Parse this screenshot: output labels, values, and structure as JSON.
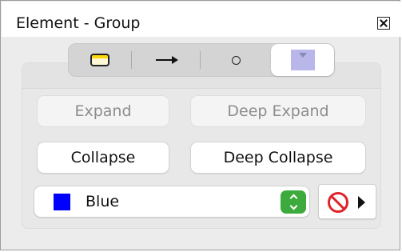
{
  "window": {
    "title": "Element - Group"
  },
  "toolbar": {
    "segments": [
      {
        "icon": "frame-icon",
        "selected": false
      },
      {
        "icon": "arrow-icon",
        "selected": false
      },
      {
        "icon": "circle-icon",
        "selected": false
      },
      {
        "icon": "group-icon",
        "selected": true,
        "color": "#b9b6ea"
      }
    ]
  },
  "actions": {
    "expand_label": "Expand",
    "deep_expand_label": "Deep Expand",
    "collapse_label": "Collapse",
    "deep_collapse_label": "Deep Collapse"
  },
  "color_select": {
    "value": "Blue",
    "swatch_color": "#0000ff",
    "stepper_color": "#3caa3c"
  },
  "none_button": {
    "icon": "no-entry-icon",
    "arrow_icon": "play-icon"
  }
}
